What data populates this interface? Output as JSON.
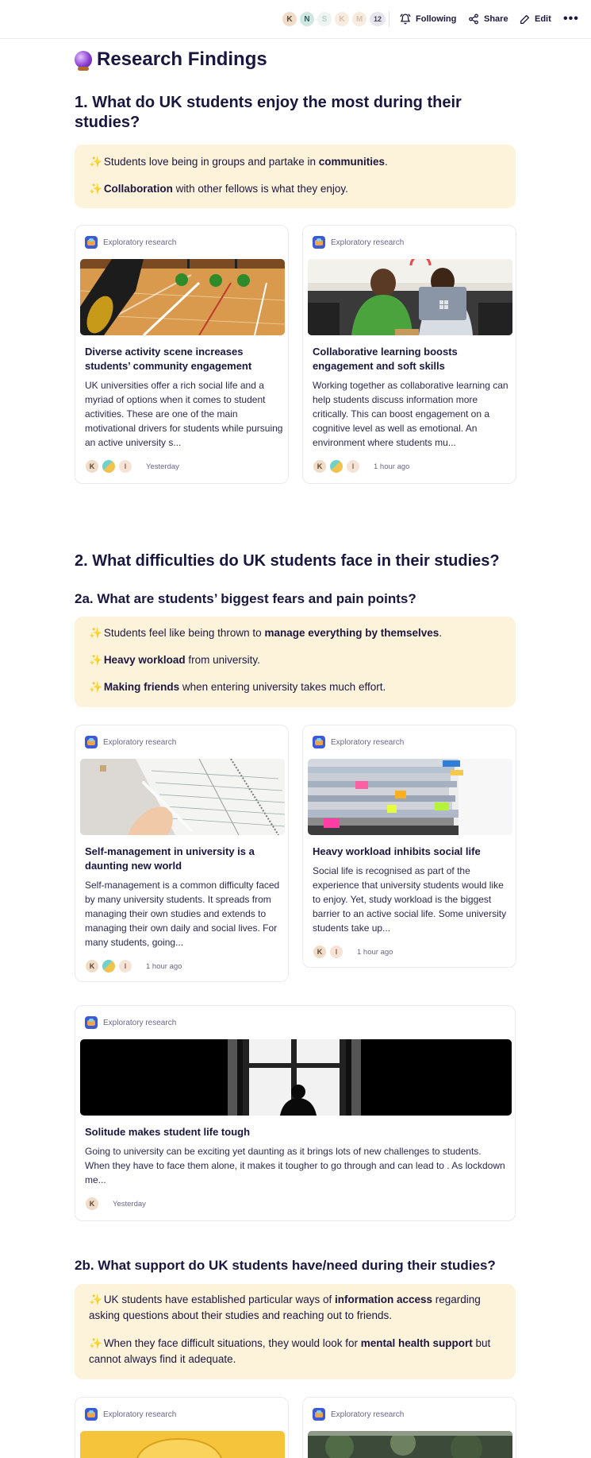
{
  "topbar": {
    "avatars": [
      "K",
      "N",
      "S",
      "K",
      "M"
    ],
    "avatar_count": "12",
    "following": "Following",
    "share": "Share",
    "edit": "Edit",
    "more": "•••"
  },
  "page": {
    "title": "Research Findings"
  },
  "section1": {
    "heading": "1. What do UK students enjoy the most during their studies?",
    "callout": [
      {
        "pre": "Students love being in groups and partake in ",
        "bold": "communities",
        "post": "."
      },
      {
        "pre": "",
        "bold": "Collaboration",
        "post": " with other fellows is what they enjoy."
      }
    ],
    "cards": [
      {
        "source": "Exploratory research",
        "title": "Diverse activity scene increases students’ community engagement",
        "body": "UK universities offer a rich social life and a myriad of options when it comes to student activities. These are one of the main motivational drivers for students while pursuing an active university s...",
        "avatars": [
          "K",
          "",
          "I"
        ],
        "time": "Yesterday"
      },
      {
        "source": "Exploratory research",
        "title": "Collaborative learning boosts engagement and soft skills",
        "body": "Working together as collaborative learning can help students discuss information more critically. This can boost engagement on a cognitive level as well as emotional. An environment where students mu...",
        "avatars": [
          "K",
          "",
          "I"
        ],
        "time": "1 hour ago"
      }
    ]
  },
  "section2": {
    "heading": "2. What difficulties do UK students face in their studies?",
    "sub_a": {
      "heading": "2a. What are students’ biggest fears and pain points?",
      "callout": [
        {
          "pre": "Students feel like being thrown to ",
          "bold": "manage everything by themselves",
          "post": "."
        },
        {
          "pre": "",
          "bold": "Heavy workload",
          "post": " from university."
        },
        {
          "pre": "",
          "bold": "Making friends",
          "post": " when entering university takes much effort."
        }
      ],
      "cards": [
        {
          "source": "Exploratory research",
          "title": "Self-management in university is a daunting new world",
          "body": "Self-management is a common difficulty faced by many university students. It spreads from managing their own studies and extends to managing their own daily and social lives. For many students, going...",
          "avatars": [
            "K",
            "",
            "I"
          ],
          "time": "1 hour ago"
        },
        {
          "source": "Exploratory research",
          "title": "Heavy workload inhibits social life",
          "body": "Social life is recognised as part of the experience that university students would like to enjoy. Yet, study workload is the biggest barrier to an active social life. Some university students take up...",
          "avatars": [
            "K",
            "I"
          ],
          "time": "1 hour ago"
        },
        {
          "source": "Exploratory research",
          "title": "Solitude makes student life tough",
          "body": "Going to university can be exciting yet daunting as it brings lots of new challenges to students. When they have to face them alone, it makes it tougher to go through and can lead to . As lockdown me...",
          "avatars": [
            "K"
          ],
          "time": "Yesterday"
        }
      ]
    },
    "sub_b": {
      "heading": "2b. What support do UK students have/need during their studies?",
      "callout": [
        {
          "pre": "UK students have established particular ways of ",
          "bold": "information access",
          "post": " regarding asking questions about their studies and reaching out to friends."
        },
        {
          "pre": "When they face difficult situations, they would look for ",
          "bold": "mental health support",
          "post": " but cannot always find it adequate."
        }
      ],
      "cards": [
        {
          "source": "Exploratory research"
        },
        {
          "source": "Exploratory research"
        }
      ]
    }
  },
  "colors": {
    "callout_bg": "#fdf3da",
    "text": "#1b1640",
    "muted": "#6a6689",
    "sparkle": "#e9b220"
  },
  "icons": [
    "bell-icon",
    "share-icon",
    "pencil-icon",
    "more-icon",
    "crystal-ball-icon",
    "sparkle-icon",
    "source-icon"
  ]
}
